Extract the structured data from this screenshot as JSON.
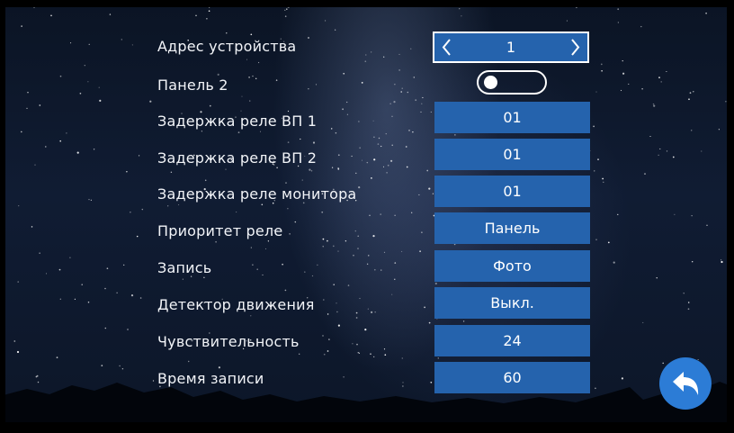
{
  "settings": {
    "device_address": {
      "label": "Адрес устройства",
      "value": "1"
    },
    "panel2": {
      "label": "Панель 2",
      "state": "off"
    },
    "rows": [
      {
        "label": "Задержка реле ВП 1",
        "value": "01"
      },
      {
        "label": "Задержка реле ВП 2",
        "value": "01"
      },
      {
        "label": "Задержка реле монитора",
        "value": "01"
      },
      {
        "label": "Приоритет реле",
        "value": "Панель"
      },
      {
        "label": "Запись",
        "value": "Фото"
      },
      {
        "label": "Детектор движения",
        "value": "Выкл."
      },
      {
        "label": "Чувствительность",
        "value": "24"
      },
      {
        "label": "Время записи",
        "value": "60"
      }
    ]
  },
  "icons": {
    "left": "chevron-left-icon",
    "right": "chevron-right-icon",
    "back": "back-arrow-icon"
  },
  "colors": {
    "button": "#2563ad",
    "back_button": "#2c7cd6",
    "text": "#ffffff"
  }
}
